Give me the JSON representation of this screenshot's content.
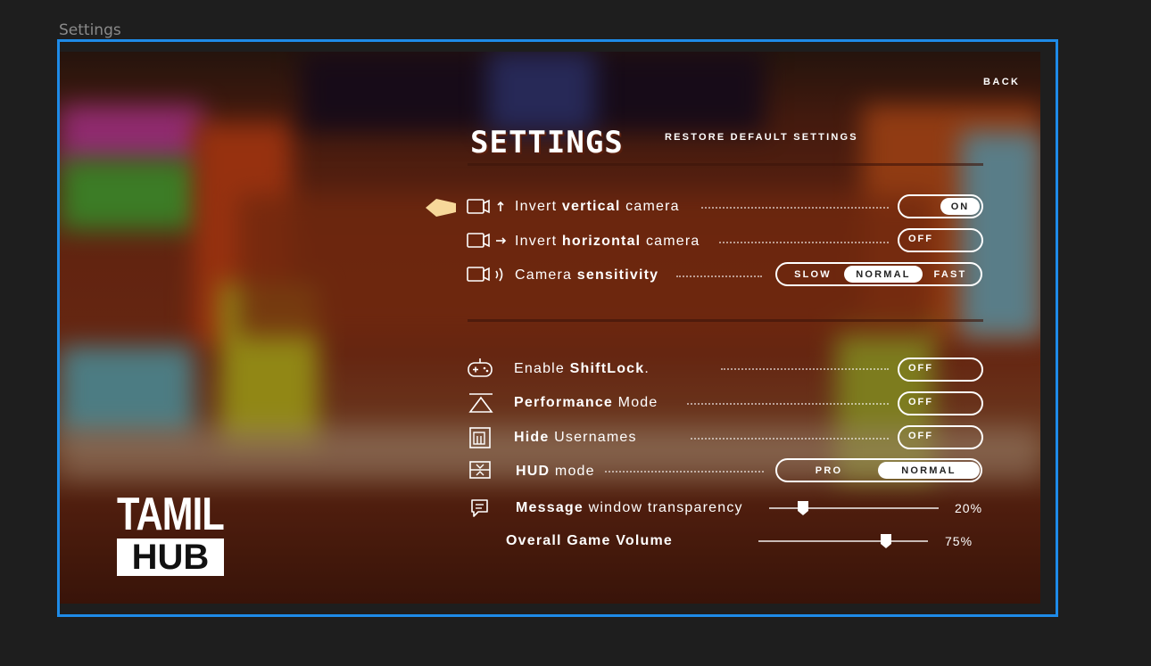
{
  "frame_label": "Settings",
  "header": {
    "back_label": "BACK",
    "title": "SETTINGS",
    "restore_label": "RESTORE DEFAULT SETTINGS"
  },
  "camera_settings": [
    {
      "label_pre": "Invert ",
      "label_bold": "vertical",
      "label_post": " camera",
      "type": "toggle",
      "value": "ON",
      "icon": "camera-up-arrow-icon",
      "selected": true
    },
    {
      "label_pre": "Invert ",
      "label_bold": "horizontal",
      "label_post": " camera",
      "type": "toggle",
      "value": "OFF",
      "icon": "camera-right-arrow-icon"
    },
    {
      "label_pre": "Camera ",
      "label_bold": "sensitivity",
      "label_post": "",
      "type": "segmented",
      "options": [
        "SLOW",
        "NORMAL",
        "FAST"
      ],
      "selected": "NORMAL",
      "icon": "camera-sound-icon"
    }
  ],
  "general_settings": [
    {
      "label_pre": "Enable ",
      "label_bold": "ShiftLock",
      "label_post": ".",
      "type": "toggle",
      "value": "OFF",
      "icon": "gamepad-icon"
    },
    {
      "label_pre": "",
      "label_bold": "Performance",
      "label_post": " Mode",
      "type": "toggle",
      "value": "OFF",
      "icon": "triangle-icon"
    },
    {
      "label_pre": "",
      "label_bold": "Hide",
      "label_post": " Usernames",
      "type": "toggle",
      "value": "OFF",
      "icon": "id-card-icon"
    },
    {
      "label_pre": "",
      "label_bold": "HUD",
      "label_post": " mode",
      "type": "segmented",
      "options": [
        "PRO",
        "NORMAL"
      ],
      "selected": "NORMAL",
      "icon": "hud-icon"
    },
    {
      "label_pre": "",
      "label_bold": "Message",
      "label_post": " window transparency",
      "type": "slider",
      "value": "20%",
      "fraction": 0.2,
      "icon": "message-icon"
    },
    {
      "label_pre": "",
      "label_bold": "Overall Game Volume",
      "label_post": "",
      "type": "slider",
      "value": "75%",
      "fraction": 0.75
    }
  ],
  "logo": {
    "line1": "TAMIL",
    "line2": "HUB"
  },
  "colors": {
    "frame_border": "#1e8be8",
    "selector_arrow": "#f7d89a"
  }
}
